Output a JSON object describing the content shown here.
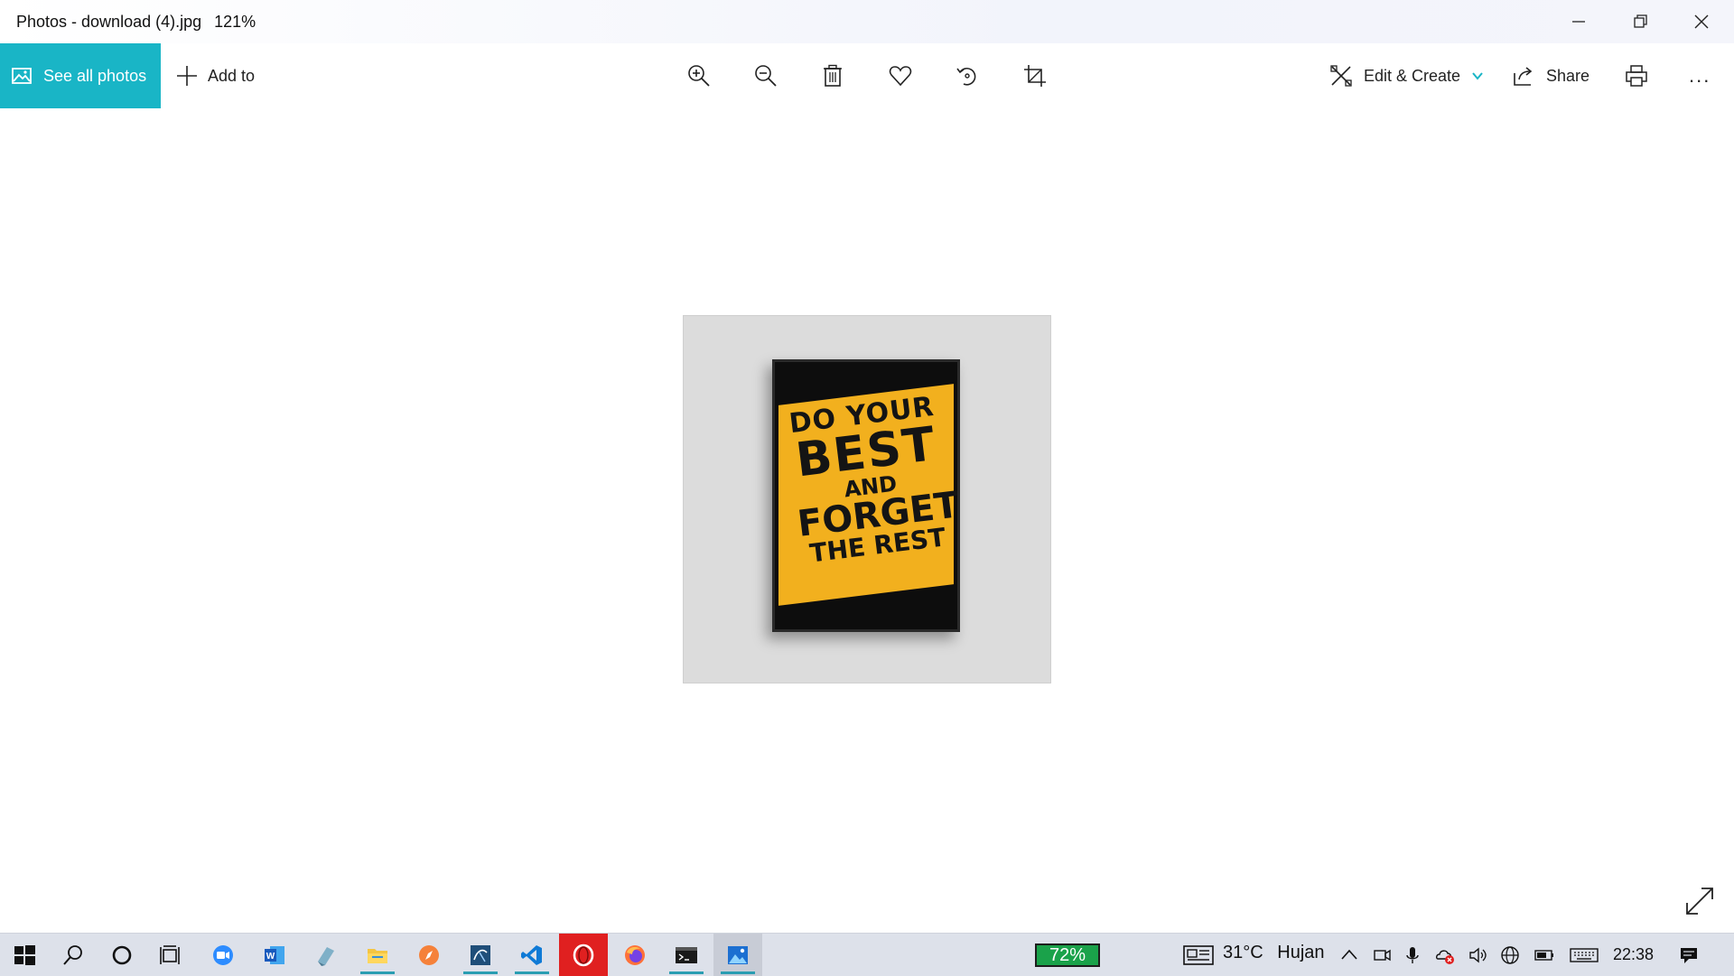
{
  "window": {
    "title": "Photos - download (4).jpg",
    "zoom": "121%"
  },
  "toolbar": {
    "see_all_label": "See all photos",
    "add_to_label": "Add to",
    "edit_create_label": "Edit & Create",
    "share_label": "Share",
    "more_label": "..."
  },
  "photo": {
    "lines": [
      "DO YOUR",
      "BEST",
      "AND",
      "FORGET",
      "THE REST"
    ]
  },
  "taskbar": {
    "battery_overlay": "72%",
    "weather_temp": "31°C",
    "weather_desc": "Hujan",
    "time": "22:38"
  },
  "colors": {
    "accent": "#19b5c6",
    "poster_yellow": "#f2b01e",
    "battery_green": "#1aa24a",
    "opera_red": "#e02020"
  }
}
